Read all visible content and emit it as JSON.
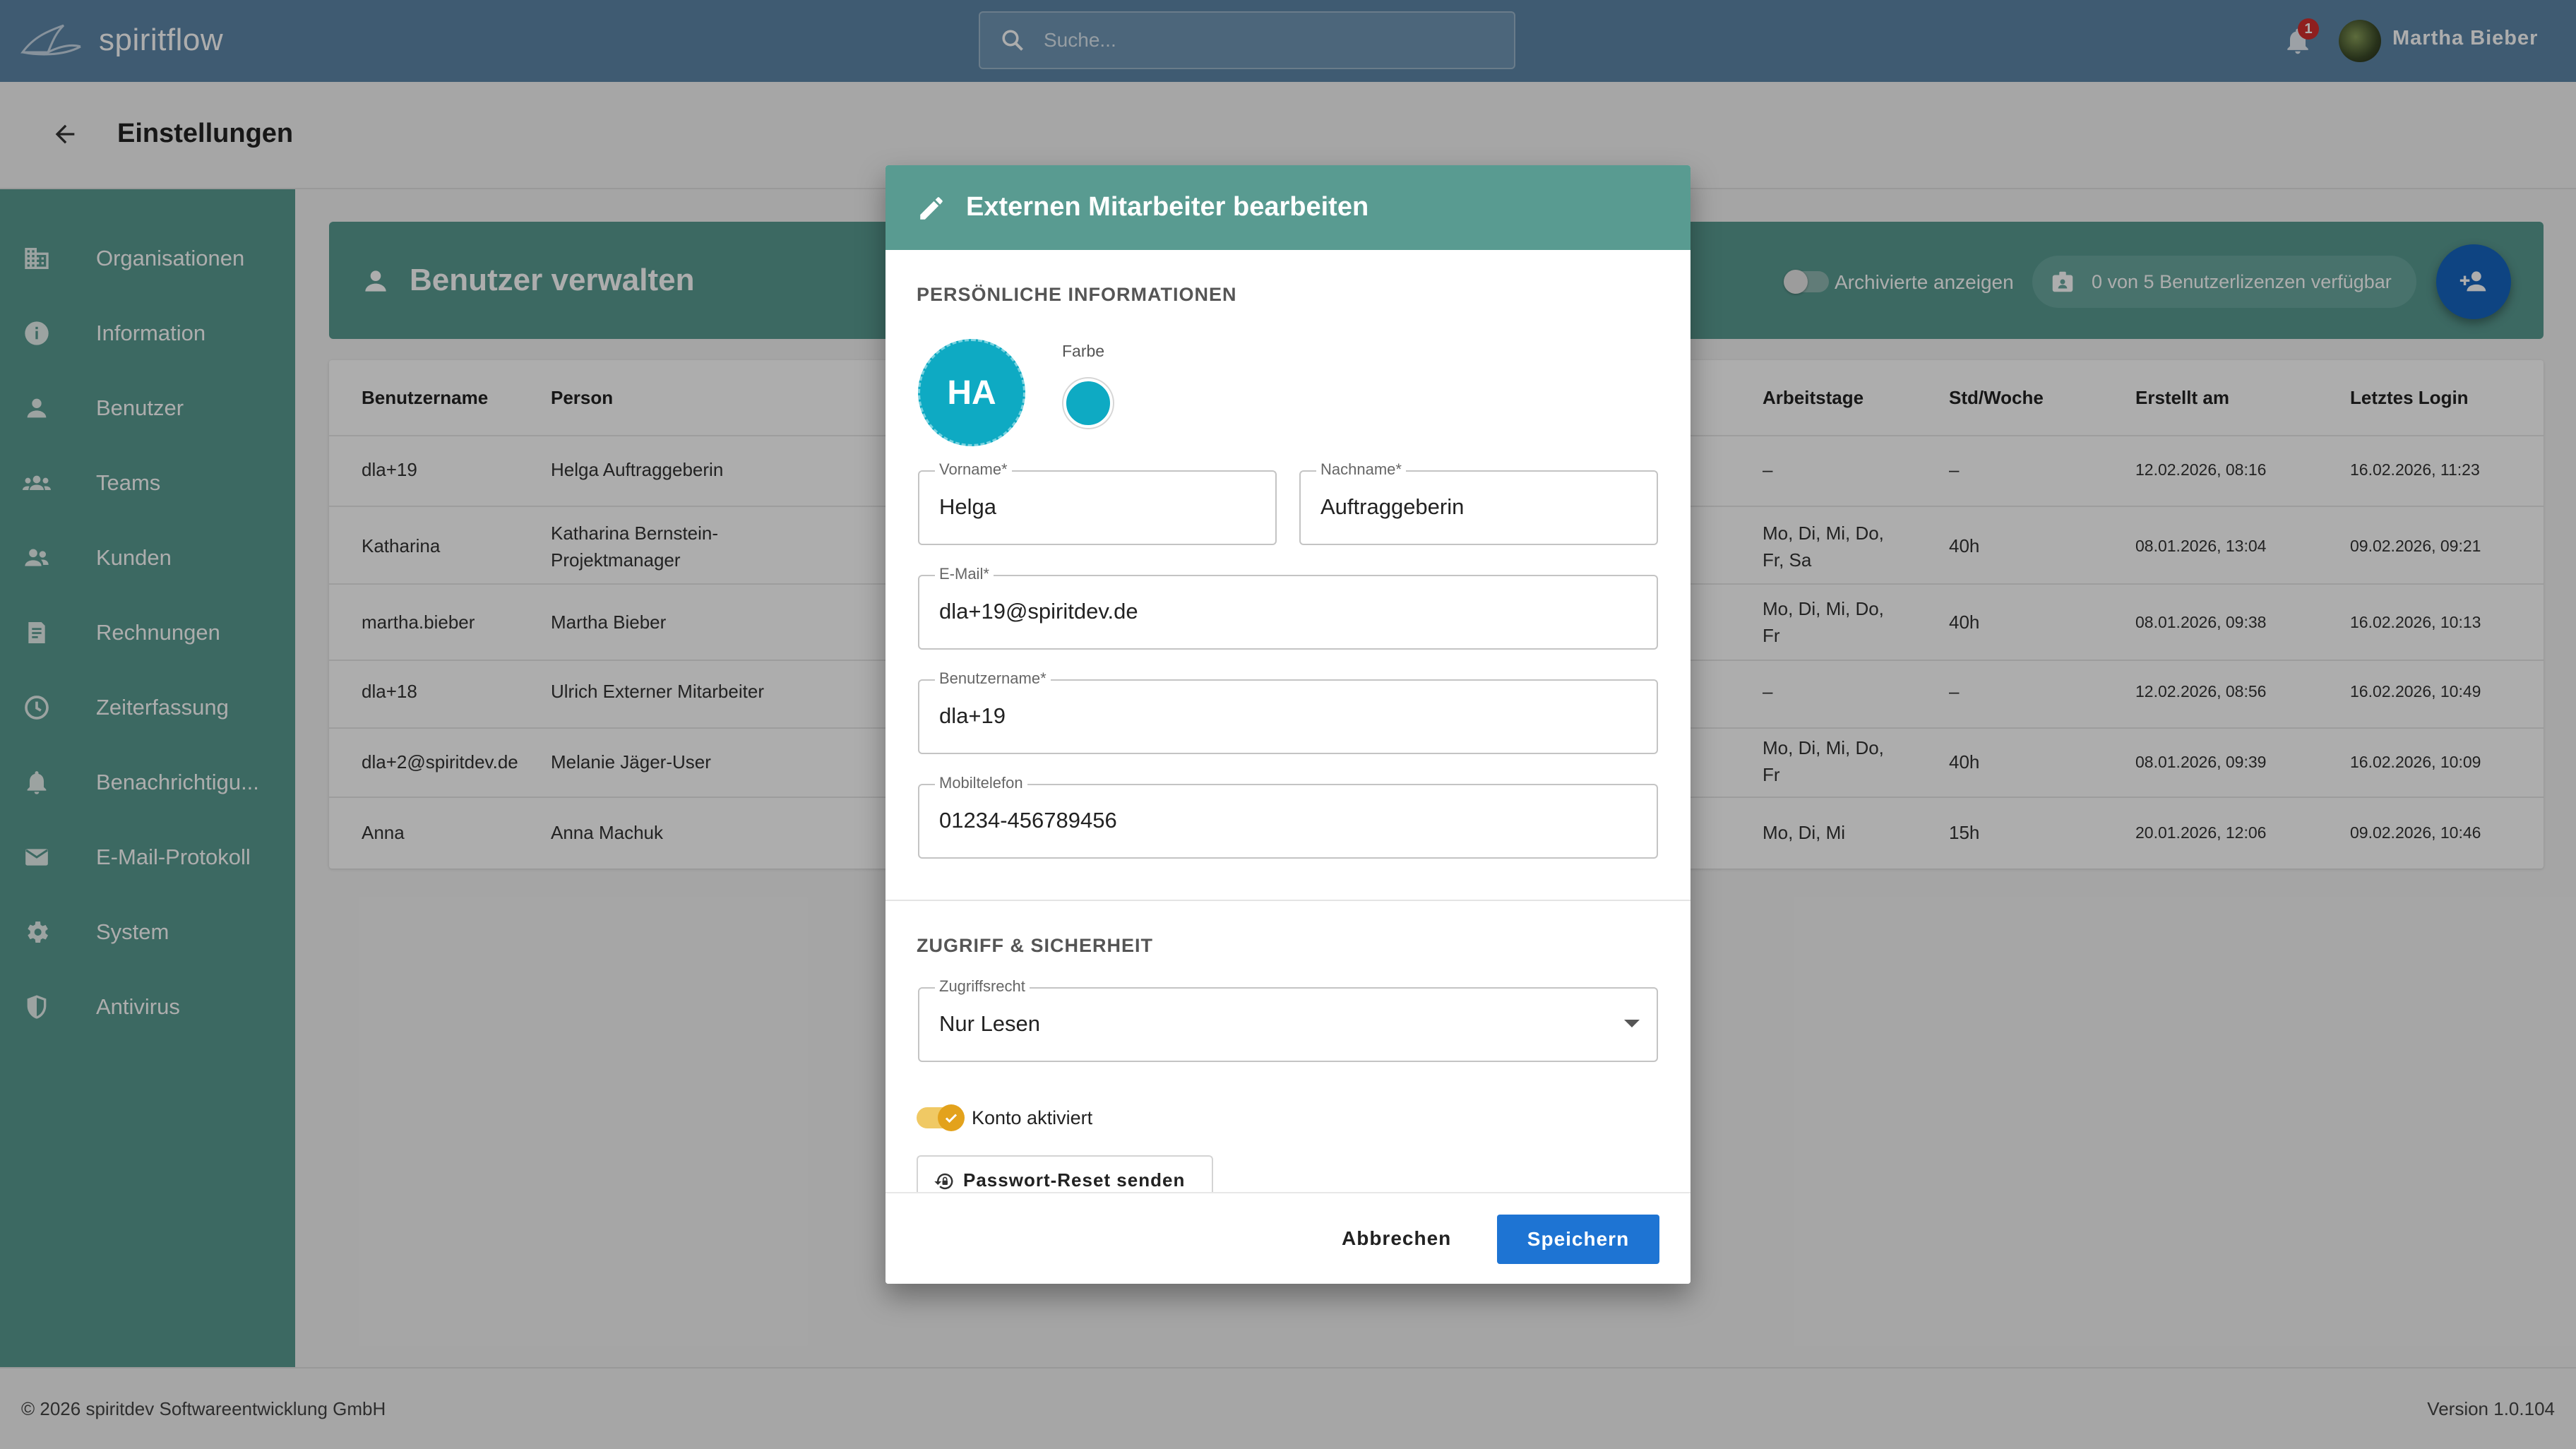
{
  "app": {
    "brand": "spiritflow",
    "search_placeholder": "Suche...",
    "notification_count": "1",
    "user_name": "Martha Bieber"
  },
  "page": {
    "title": "Einstellungen"
  },
  "sidebar": {
    "items": [
      {
        "label": "Organisationen",
        "icon": "building-icon"
      },
      {
        "label": "Information",
        "icon": "info-icon"
      },
      {
        "label": "Benutzer",
        "icon": "person-icon"
      },
      {
        "label": "Teams",
        "icon": "groups-icon"
      },
      {
        "label": "Kunden",
        "icon": "people-icon"
      },
      {
        "label": "Rechnungen",
        "icon": "receipt-icon"
      },
      {
        "label": "Zeiterfassung",
        "icon": "clock-icon"
      },
      {
        "label": "Benachrichtigu...",
        "icon": "bell-icon"
      },
      {
        "label": "E-Mail-Protokoll",
        "icon": "mail-icon"
      },
      {
        "label": "System",
        "icon": "gear-icon"
      },
      {
        "label": "Antivirus",
        "icon": "shield-icon"
      }
    ]
  },
  "users": {
    "title": "Benutzer verwalten",
    "archived_label": "Archivierte anzeigen",
    "license_label": "0 von 5 Benutzerlizenzen verfügbar",
    "columns": [
      "Benutzername",
      "Person",
      "Arbeitstage",
      "Std/Woche",
      "Erstellt am",
      "Letztes Login"
    ],
    "rows": [
      {
        "username": "dla+19",
        "person": [
          "Helga Auftraggeberin"
        ],
        "days": [
          "–"
        ],
        "hours": "–",
        "created": "12.02.2026, 08:16",
        "login": "16.02.2026, 11:23"
      },
      {
        "username": "Katharina",
        "person": [
          "Katharina Bernstein-",
          "Projektmanager"
        ],
        "days": [
          "Mo, Di, Mi, Do,",
          "Fr, Sa"
        ],
        "hours": "40h",
        "created": "08.01.2026, 13:04",
        "login": "09.02.2026, 09:21"
      },
      {
        "username": "martha.bieber",
        "person": [
          "Martha Bieber"
        ],
        "days": [
          "Mo, Di, Mi, Do,",
          "Fr"
        ],
        "hours": "40h",
        "created": "08.01.2026, 09:38",
        "login": "16.02.2026, 10:13"
      },
      {
        "username": "dla+18",
        "person": [
          "Ulrich Externer Mitarbeiter"
        ],
        "days": [
          "–"
        ],
        "hours": "–",
        "created": "12.02.2026, 08:56",
        "login": "16.02.2026, 10:49"
      },
      {
        "username": "dla+2@spiritdev.de",
        "person": [
          "Melanie Jäger-User"
        ],
        "days": [
          "Mo, Di, Mi, Do,",
          "Fr"
        ],
        "hours": "40h",
        "created": "08.01.2026, 09:39",
        "login": "16.02.2026, 10:09"
      },
      {
        "username": "Anna",
        "person": [
          "Anna Machuk"
        ],
        "days": [
          "Mo, Di, Mi"
        ],
        "hours": "15h",
        "created": "20.01.2026, 12:06",
        "login": "09.02.2026, 10:46"
      }
    ]
  },
  "dialog": {
    "title": "Externen Mitarbeiter bearbeiten",
    "section_personal": "PERSÖNLICHE INFORMATIONEN",
    "initials": "HA",
    "color_label": "Farbe",
    "color_value": "#0eaac3",
    "fields": {
      "firstname": {
        "label": "Vorname*",
        "value": "Helga"
      },
      "lastname": {
        "label": "Nachname*",
        "value": "Auftraggeberin"
      },
      "email": {
        "label": "E-Mail*",
        "value": "dla+19@spiritdev.de"
      },
      "username": {
        "label": "Benutzername*",
        "value": "dla+19"
      },
      "mobile": {
        "label": "Mobiltelefon",
        "value": "01234-456789456"
      }
    },
    "section_access": "ZUGRIFF & SICHERHEIT",
    "access": {
      "label": "Zugriffsrecht",
      "value": "Nur Lesen"
    },
    "account_active_label": "Konto aktiviert",
    "account_active": true,
    "reset_button": "Passwort-Reset senden",
    "cancel_button": "Abbrechen",
    "save_button": "Speichern"
  },
  "footer": {
    "copyright": "© 2026 spiritdev Softwareentwicklung GmbH",
    "version": "Version 1.0.104"
  },
  "colors": {
    "topbar": "#5d87a8",
    "teal": "#599b91",
    "primary": "#1e74d3",
    "toggle": "#e3a21c"
  }
}
